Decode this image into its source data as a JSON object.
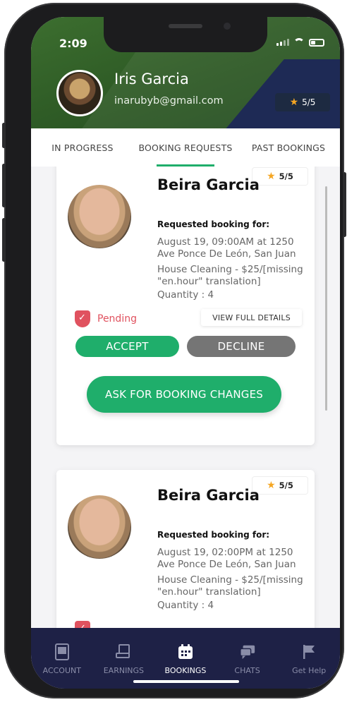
{
  "status": {
    "time": "2:09"
  },
  "profile": {
    "name": "Iris Garcia",
    "email": "inarubyb@gmail.com",
    "rating": "5/5"
  },
  "tabs": [
    {
      "label": "IN PROGRESS"
    },
    {
      "label": "BOOKING REQUESTS"
    },
    {
      "label": "PAST BOOKINGS"
    }
  ],
  "bookings": [
    {
      "name": "Beira Garcia",
      "rating": "5/5",
      "requested_label": "Requested booking for:",
      "datetime": "August 19, 09:00AM at 1250 Ave Ponce De León, San Juan",
      "service": "House Cleaning - $25/[missing \"en.hour\" translation]",
      "quantity": "Quantity : 4",
      "status": "Pending",
      "view_label": "VIEW FULL DETAILS",
      "accept_label": "ACCEPT",
      "decline_label": "DECLINE",
      "ask_label": "ASK FOR BOOKING CHANGES"
    },
    {
      "name": "Beira Garcia",
      "rating": "5/5",
      "requested_label": "Requested booking for:",
      "datetime": "August 19, 02:00PM at 1250 Ave Ponce De León, San Juan",
      "service": "House Cleaning - $25/[missing \"en.hour\" translation]",
      "quantity": "Quantity : 4"
    }
  ],
  "nav": [
    {
      "label": "ACCOUNT",
      "icon": "account-icon"
    },
    {
      "label": "EARNINGS",
      "icon": "earnings-icon"
    },
    {
      "label": "BOOKINGS",
      "icon": "calendar-icon"
    },
    {
      "label": "CHATS",
      "icon": "chat-icon"
    },
    {
      "label": "Get Help",
      "icon": "flag-icon"
    }
  ],
  "colors": {
    "accent": "#1fae6b",
    "decline": "#757575",
    "pending": "#e0525f",
    "nav_bg": "#1e2146",
    "header_green": "#2f5c26"
  }
}
